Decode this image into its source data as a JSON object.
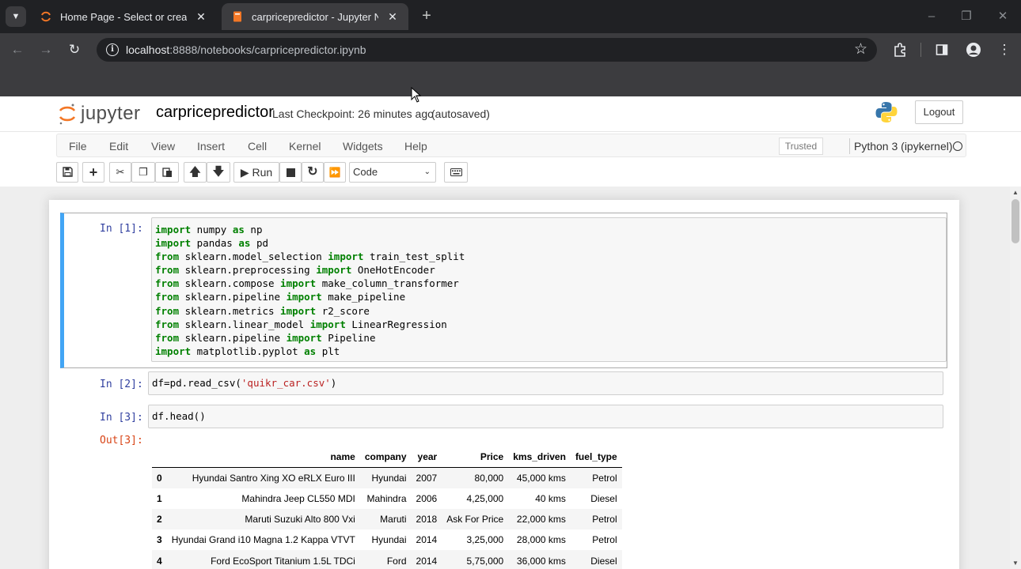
{
  "browser": {
    "tabs": [
      {
        "title": "Home Page - Select or create a notebook",
        "active": false
      },
      {
        "title": "carpricepredictor - Jupyter Notebook",
        "active": true
      }
    ],
    "new_tab_icon": "plus-icon",
    "address": {
      "host": "localhost",
      "path": ":8888/notebooks/carpricepredictor.ipynb"
    }
  },
  "jupyter": {
    "logo_text": "jupyter",
    "notebook_name": "carpricepredictor",
    "checkpoint": "Last Checkpoint: 26 minutes ago",
    "autosave": "(autosaved)",
    "logout_label": "Logout"
  },
  "menubar": {
    "items": [
      "File",
      "Edit",
      "View",
      "Insert",
      "Cell",
      "Kernel",
      "Widgets",
      "Help"
    ],
    "trusted": "Trusted",
    "kernel": "Python 3 (ipykernel)"
  },
  "toolbar": {
    "run_label": "Run",
    "cell_type": "Code"
  },
  "cells": [
    {
      "prompt": "In [1]:",
      "lines": [
        [
          [
            "kw",
            "import"
          ],
          [
            "t",
            " numpy "
          ],
          [
            "kw",
            "as"
          ],
          [
            "t",
            " np"
          ]
        ],
        [
          [
            "kw",
            "import"
          ],
          [
            "t",
            " pandas "
          ],
          [
            "kw",
            "as"
          ],
          [
            "t",
            " pd"
          ]
        ],
        [
          [
            "kw",
            "from"
          ],
          [
            "t",
            " sklearn.model_selection "
          ],
          [
            "kw",
            "import"
          ],
          [
            "t",
            " train_test_split"
          ]
        ],
        [
          [
            "kw",
            "from"
          ],
          [
            "t",
            " sklearn.preprocessing "
          ],
          [
            "kw",
            "import"
          ],
          [
            "t",
            " OneHotEncoder"
          ]
        ],
        [
          [
            "kw",
            "from"
          ],
          [
            "t",
            " sklearn.compose "
          ],
          [
            "kw",
            "import"
          ],
          [
            "t",
            " make_column_transformer"
          ]
        ],
        [
          [
            "kw",
            "from"
          ],
          [
            "t",
            " sklearn.pipeline "
          ],
          [
            "kw",
            "import"
          ],
          [
            "t",
            " make_pipeline"
          ]
        ],
        [
          [
            "kw",
            "from"
          ],
          [
            "t",
            " sklearn.metrics "
          ],
          [
            "kw",
            "import"
          ],
          [
            "t",
            " r2_score"
          ]
        ],
        [
          [
            "kw",
            "from"
          ],
          [
            "t",
            " sklearn.linear_model "
          ],
          [
            "kw",
            "import"
          ],
          [
            "t",
            " LinearRegression"
          ]
        ],
        [
          [
            "kw",
            "from"
          ],
          [
            "t",
            " sklearn.pipeline "
          ],
          [
            "kw",
            "import"
          ],
          [
            "t",
            " Pipeline"
          ]
        ],
        [
          [
            "kw",
            "import"
          ],
          [
            "t",
            " matplotlib.pyplot "
          ],
          [
            "kw",
            "as"
          ],
          [
            "t",
            " plt"
          ]
        ]
      ]
    },
    {
      "prompt": "In [2]:",
      "lines": [
        [
          [
            "t",
            "df=pd.read_csv("
          ],
          [
            "str",
            "'quikr_car.csv'"
          ],
          [
            "t",
            ")"
          ]
        ]
      ]
    },
    {
      "prompt": "In [3]:",
      "lines": [
        [
          [
            "t",
            "df.head()"
          ]
        ]
      ]
    }
  ],
  "output": {
    "prompt": "Out[3]:",
    "columns": [
      "name",
      "company",
      "year",
      "Price",
      "kms_driven",
      "fuel_type"
    ],
    "rows": [
      {
        "index": "0",
        "values": [
          "Hyundai Santro Xing XO eRLX Euro III",
          "Hyundai",
          "2007",
          "80,000",
          "45,000 kms",
          "Petrol"
        ]
      },
      {
        "index": "1",
        "values": [
          "Mahindra Jeep CL550 MDI",
          "Mahindra",
          "2006",
          "4,25,000",
          "40 kms",
          "Diesel"
        ]
      },
      {
        "index": "2",
        "values": [
          "Maruti Suzuki Alto 800 Vxi",
          "Maruti",
          "2018",
          "Ask For Price",
          "22,000 kms",
          "Petrol"
        ]
      },
      {
        "index": "3",
        "values": [
          "Hyundai Grand i10 Magna 1.2 Kappa VTVT",
          "Hyundai",
          "2014",
          "3,25,000",
          "28,000 kms",
          "Petrol"
        ]
      },
      {
        "index": "4",
        "values": [
          "Ford EcoSport Titanium 1.5L TDCi",
          "Ford",
          "2014",
          "5,75,000",
          "36,000 kms",
          "Diesel"
        ]
      }
    ]
  },
  "colors": {
    "prompt_in": "#303f9f",
    "prompt_out": "#d84315",
    "selected_cell_bar": "#42a5f5",
    "keyword": "#008000",
    "string": "#ba2121"
  }
}
